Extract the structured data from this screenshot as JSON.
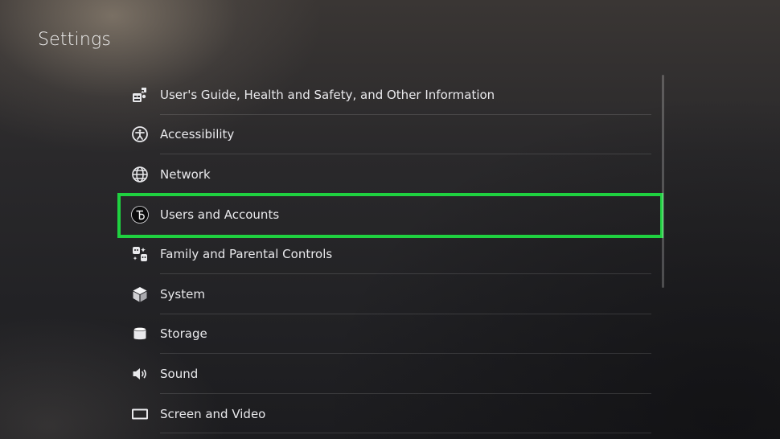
{
  "header": {
    "title": "Settings"
  },
  "menu": {
    "items": [
      {
        "label": "User's Guide, Health and Safety, and Other Information",
        "icon": "guide-icon"
      },
      {
        "label": "Accessibility",
        "icon": "accessibility-icon"
      },
      {
        "label": "Network",
        "icon": "globe-icon"
      },
      {
        "label": "Users and Accounts",
        "icon": "user-avatar-icon",
        "focused": true
      },
      {
        "label": "Family and Parental Controls",
        "icon": "family-icon"
      },
      {
        "label": "System",
        "icon": "cube-icon"
      },
      {
        "label": "Storage",
        "icon": "storage-icon"
      },
      {
        "label": "Sound",
        "icon": "speaker-icon"
      },
      {
        "label": "Screen and Video",
        "icon": "screen-icon"
      }
    ]
  },
  "colors": {
    "highlight": "#1fd140",
    "text": "#e9e9ec"
  }
}
